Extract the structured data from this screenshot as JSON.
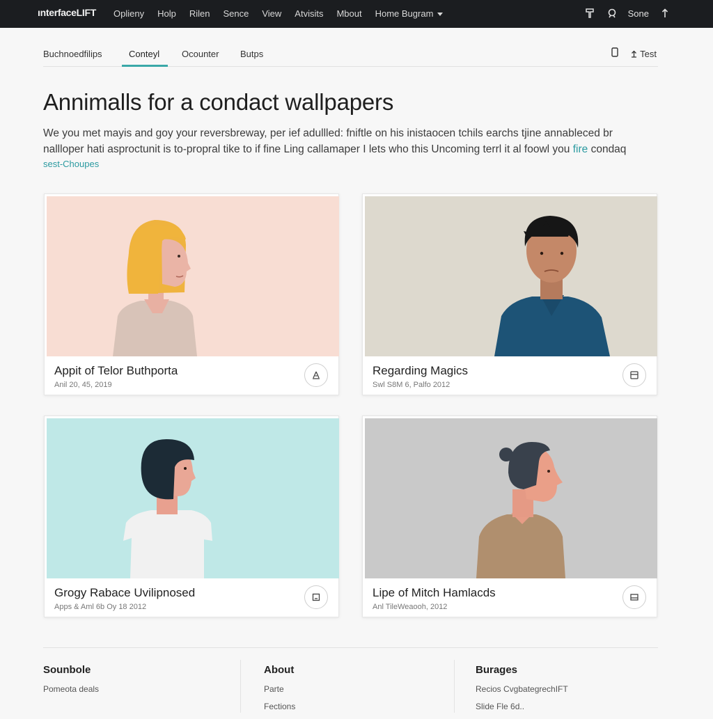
{
  "header": {
    "logo": "ınterfaceLIFT",
    "nav": [
      "Oplieny",
      "Holp",
      "Rilen",
      "Sence",
      "View",
      "Atvisits",
      "Mbout",
      "Home Bugram"
    ],
    "user": "Sone"
  },
  "tabs": {
    "items": [
      "Buchnoedfilips",
      "Conteyl",
      "Ocounter",
      "Butps"
    ],
    "active": "Conteyl",
    "right_label": "Test"
  },
  "main": {
    "title": "Annimalls for a condact wallpapers",
    "intro_line1": "We you met mayis and goy your reversbreway, per ief adullled: fniftle on his inistaocen tchils earchs tjine annableced br",
    "intro_line2_start": "nallloper hati asproctunit is to-propral tike to if fine Ling callamaper  I lets who this Uncoming terrl it al foowl you ",
    "intro_line2_accent": "fire",
    "intro_line2_end": " condaq",
    "intro_tag": "sest-Choupes"
  },
  "cards": [
    {
      "title": "Appit of Telor Buthporta",
      "date": "Anil 20, 45, 2019",
      "bg": "#f7ddd4",
      "icon": "person-pin-icon"
    },
    {
      "title": "Regarding Magics",
      "date": "Swl S8M 6, Palfo 2012",
      "bg": "#ddd9cf",
      "icon": "save-icon"
    },
    {
      "title": "Grogy Rabace Uvilipnosed",
      "date": "Apps & Aml 6b Oy 18 2012",
      "bg": "#bde7e6",
      "icon": "square-icon"
    },
    {
      "title": "Lipe of Mitch Hamlacds",
      "date": "Anl TileWeaooh, 2012",
      "bg": "#c8c8c8",
      "icon": "card-icon"
    }
  ],
  "footer": {
    "col1": {
      "heading": "Sounbole",
      "links": [
        "Pomeota deals"
      ]
    },
    "col2": {
      "heading": "About",
      "links": [
        "Parte",
        "Fections"
      ]
    },
    "col3": {
      "heading": "Burages",
      "links": [
        "Recios CvgbategrechIFT",
        "Slide Fle 6d.."
      ]
    }
  },
  "colors": {
    "topbar": "#1b1d20",
    "accent": "#3aa8a8"
  }
}
